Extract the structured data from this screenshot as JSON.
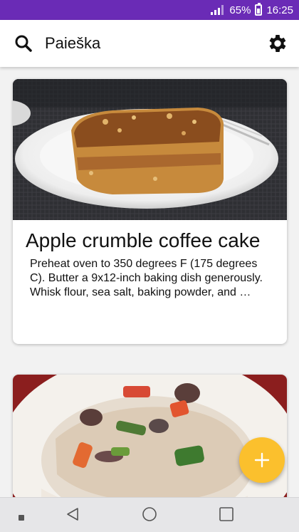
{
  "status_bar": {
    "battery": "65%",
    "time": "16:25",
    "battery_level": 0.65
  },
  "app_bar": {
    "title": "Paieška",
    "icons": [
      "search-icon",
      "settings-gear-icon"
    ]
  },
  "recipes": [
    {
      "title": "Apple crumble coffee cake",
      "description": "Preheat oven to 350 degrees F (175 degrees C). Butter a 9x12-inch baking dish generously.\nWhisk flour, sea salt, baking powder, and …"
    },
    {
      "title": "",
      "description": ""
    }
  ],
  "fab": {
    "icon": "plus-icon"
  },
  "nav_bar": {
    "icons": [
      "recents-dot-icon",
      "back-icon",
      "home-icon",
      "overview-icon"
    ]
  },
  "colors": {
    "status_bar": "#6a2bb6",
    "fab": "#fbc02d",
    "app_bar": "#ffffff"
  }
}
